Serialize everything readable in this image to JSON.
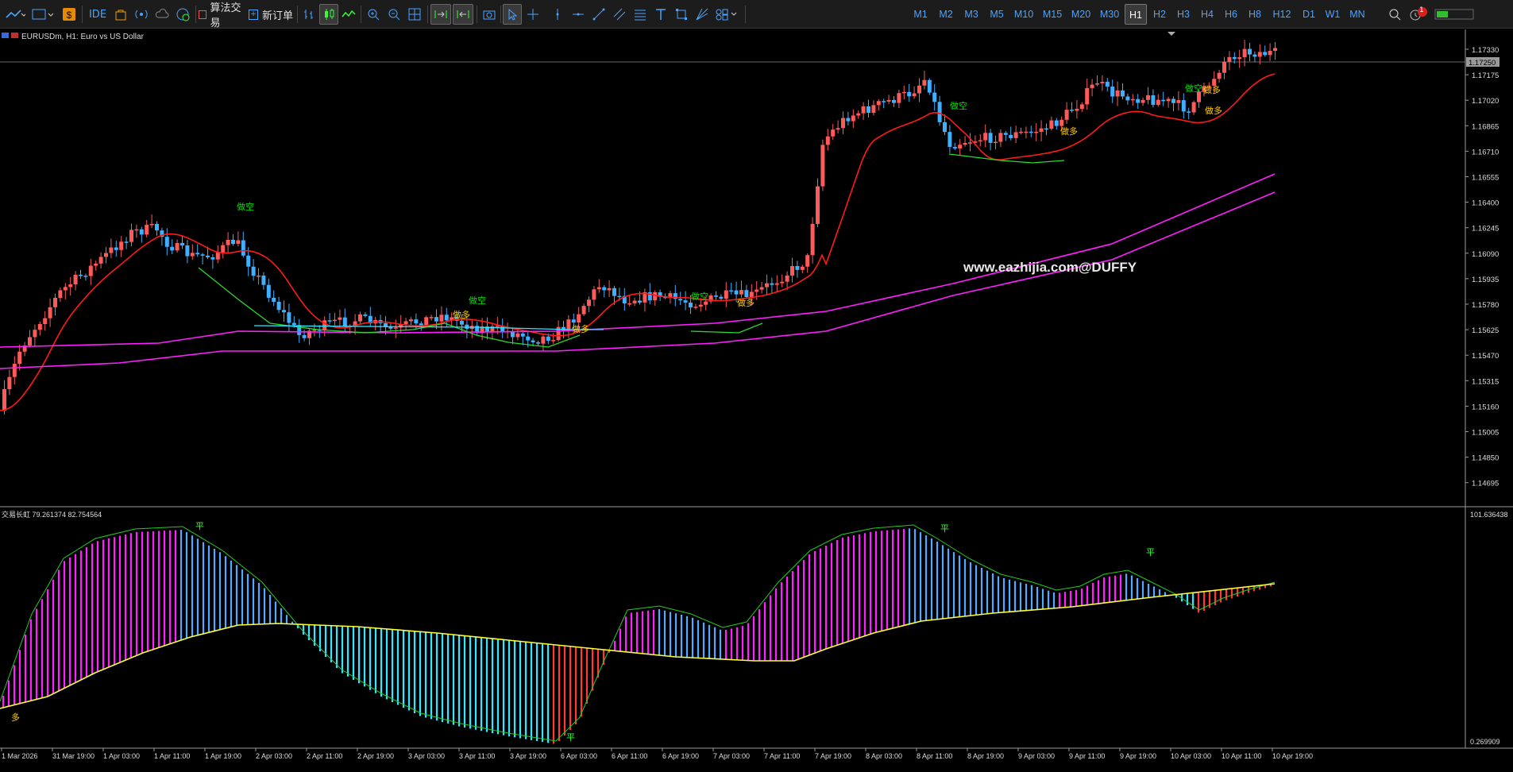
{
  "toolbar": {
    "ide_label": "IDE",
    "algo_label": "算法交易",
    "neworder_label": "新订单",
    "timeframes": [
      "M1",
      "M2",
      "M3",
      "M5",
      "M10",
      "M15",
      "M20",
      "M30",
      "H1",
      "H2",
      "H3",
      "H4",
      "H6",
      "H8",
      "H12",
      "D1",
      "W1",
      "MN"
    ],
    "selected_timeframe": "H1",
    "notification_count": "1"
  },
  "chart": {
    "symbol_title": "EURUSDm, H1:  Euro vs US Dollar",
    "price_levels": [
      "1.17330",
      "1.17175",
      "1.17020",
      "1.16865",
      "1.16710",
      "1.16555",
      "1.16400",
      "1.16245",
      "1.16090",
      "1.15935",
      "1.15780",
      "1.15625",
      "1.15470",
      "1.15315",
      "1.15160",
      "1.15005",
      "1.14850",
      "1.14695"
    ],
    "current_price": "1.17250",
    "watermark": "www.eazhijia.com@DUFFY",
    "signals": [
      {
        "text": "做空",
        "color": "#00e000"
      },
      {
        "text": "做多",
        "color": "#ffd000"
      },
      {
        "text": "做空",
        "color": "#00e000"
      },
      {
        "text": "做空",
        "color": "#00e000"
      },
      {
        "text": "做多",
        "color": "#ffd000"
      },
      {
        "text": "做多",
        "color": "#ffd000"
      },
      {
        "text": "做多",
        "color": "#ffd000"
      },
      {
        "text": "做空",
        "color": "#00e000"
      },
      {
        "text": "做多",
        "color": "#ffd000"
      },
      {
        "text": "做空",
        "color": "#00e000"
      },
      {
        "text": "做多",
        "color": "#ffd000"
      }
    ]
  },
  "indicator": {
    "title": "交易长虹 79.261374 82.754564",
    "level_top": "101.636438",
    "level_bottom": "0.269909",
    "signals": [
      "多",
      "平",
      "平",
      "平",
      "平"
    ]
  },
  "time_axis": [
    "1 Mar 2026",
    "31 Mar 19:00",
    "1 Apr 03:00",
    "1 Apr 11:00",
    "1 Apr 19:00",
    "2 Apr 03:00",
    "2 Apr 11:00",
    "2 Apr 19:00",
    "3 Apr 03:00",
    "3 Apr 11:00",
    "3 Apr 19:00",
    "6 Apr 03:00",
    "6 Apr 11:00",
    "6 Apr 19:00",
    "7 Apr 03:00",
    "7 Apr 11:00",
    "7 Apr 19:00",
    "8 Apr 03:00",
    "8 Apr 11:00",
    "8 Apr 19:00",
    "9 Apr 03:00",
    "9 Apr 11:00",
    "9 Apr 19:00",
    "10 Apr 03:00",
    "10 Apr 11:00",
    "10 Apr 19:00"
  ],
  "colors": {
    "bull": "#ff5a5a",
    "bear": "#3fb0ff",
    "ma_red": "#ff1a1a",
    "ma_magenta": "#ff20ff",
    "cyan": "#33e6ff",
    "green": "#2bd92b",
    "yellow": "#ffff33"
  }
}
